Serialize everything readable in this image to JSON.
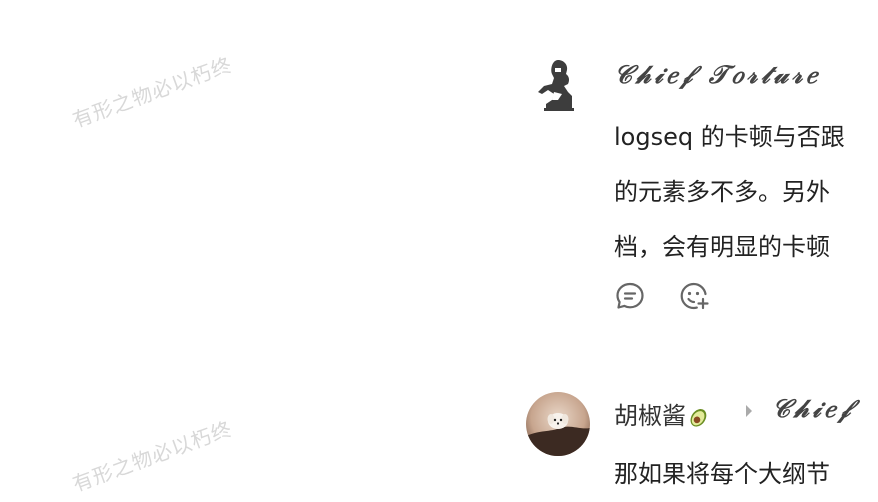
{
  "watermark": {
    "text": "有形之物必以朽终"
  },
  "comments": [
    {
      "author": "𝒞𝒽𝒾𝑒𝒻 𝒯𝑜𝓇𝓉𝓊𝓇𝑒",
      "lines": [
        "logseq 的卡顿与否跟",
        "的元素多不多。另外",
        "档，会有明显的卡顿"
      ],
      "actions": {
        "reply_icon": "reply-icon",
        "reaction_icon": "add-reaction-icon"
      }
    },
    {
      "author": "胡椒酱",
      "author_emoji": "avocado-icon",
      "reply_to": "𝒞𝒽𝒾𝑒𝒻",
      "lines": [
        "那如果将每个大纲节"
      ]
    }
  ]
}
